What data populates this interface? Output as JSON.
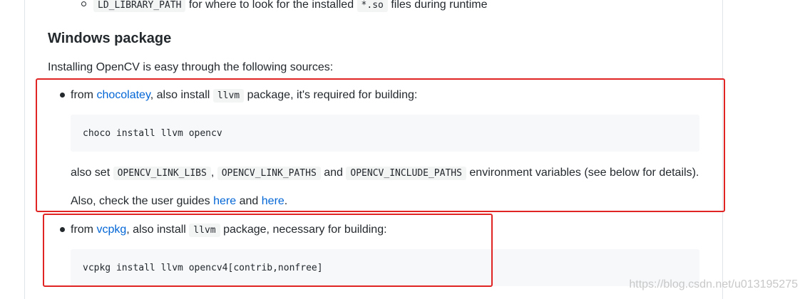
{
  "top_item": {
    "code": "LD_LIBRARY_PATH",
    "text_before_code2": "for where to look for the installed",
    "code2": "*.so",
    "text_after": "files during runtime"
  },
  "heading": "Windows package",
  "intro": "Installing OpenCV is easy through the following sources:",
  "choco_item": {
    "prefix": "from",
    "link": "chocolatey",
    "mid": ", also install",
    "code": "llvm",
    "suffix": "package, it's required for building:",
    "command": "choco install llvm opencv",
    "also_set_prefix": "also set",
    "env1": "OPENCV_LINK_LIBS",
    "sep": ",",
    "env2": "OPENCV_LINK_PATHS",
    "and": "and",
    "env3": "OPENCV_INCLUDE_PATHS",
    "also_set_suffix": "environment variables (see below for details).",
    "guides_prefix": "Also, check the user guides",
    "guides_link1": "here",
    "guides_and": "and",
    "guides_link2": "here",
    "guides_end": "."
  },
  "vcpkg_item": {
    "prefix": "from",
    "link": "vcpkg",
    "mid": ", also install",
    "code": "llvm",
    "suffix": "package, necessary for building:",
    "command": "vcpkg install llvm opencv4[contrib,nonfree]"
  },
  "watermark": "https://blog.csdn.net/u013195275",
  "colors": {
    "link": "#0366d6",
    "annotation_box": "#e02424",
    "code_bg": "#f6f8fa"
  }
}
